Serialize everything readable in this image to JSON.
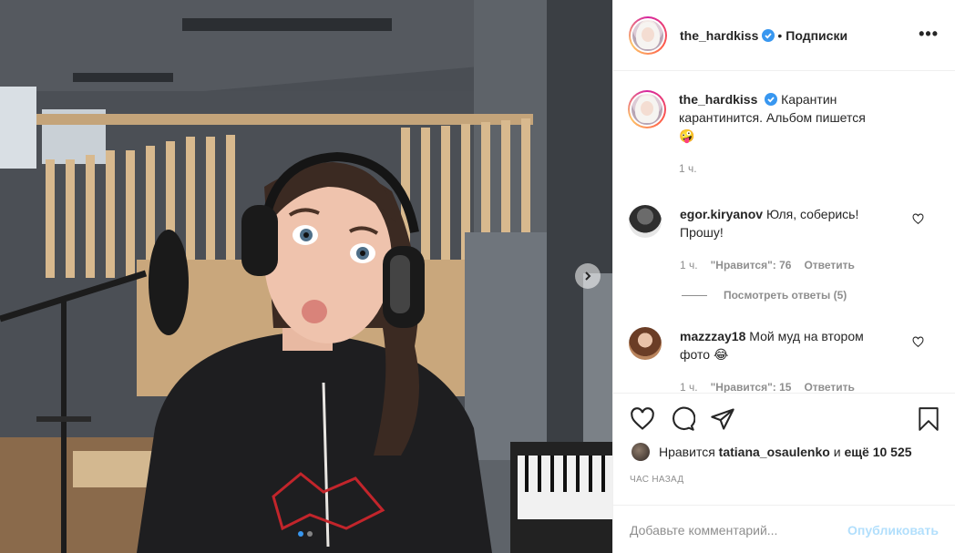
{
  "header": {
    "username": "the_hardkiss",
    "separator": "•",
    "follow_label": "Подписки",
    "more_label": "•••"
  },
  "caption": {
    "username": "the_hardkiss",
    "text": "Карантин карантинится. Альбом пишется",
    "emoji": "🤪",
    "time": "1 ч."
  },
  "comments": [
    {
      "username": "egor.kiryanov",
      "text": "Юля, соберись! Прошу!",
      "time": "1 ч.",
      "likes": "\"Нравится\": 76",
      "reply_label": "Ответить",
      "view_replies": "Посмотреть ответы (5)"
    },
    {
      "username": "mazzzay18",
      "text": "Мой муд на втором фото",
      "emoji": "😂",
      "time": "1 ч.",
      "likes": "\"Нравится\": 15",
      "reply_label": "Ответить"
    }
  ],
  "likes": {
    "prefix": "Нравится",
    "user": "tatiana_osaulenko",
    "middle": "и",
    "others": "ещё 10 525"
  },
  "timestamp": "ЧАС НАЗАД",
  "comment_box": {
    "placeholder": "Добавьте комментарий...",
    "publish_label": "Опубликовать"
  },
  "colors": {
    "accent": "#3897f0",
    "publish_disabled": "#b2dffc",
    "secondary_text": "#8e8e8e",
    "border": "#efefef"
  },
  "carousel": {
    "current": 1,
    "total": 2
  }
}
